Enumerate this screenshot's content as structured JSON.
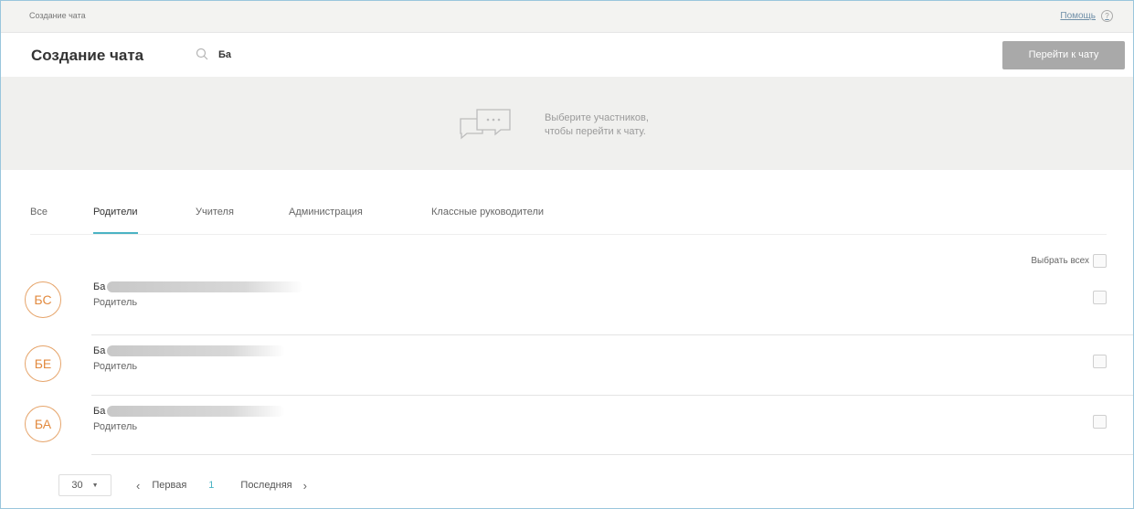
{
  "breadcrumb": "Создание чата",
  "help": {
    "label": "Помощь",
    "icon": "question-icon"
  },
  "header": {
    "title": "Создание чата",
    "search_icon": "search-icon",
    "search_value": "Ба",
    "go_button": "Перейти к чату"
  },
  "banner": {
    "icon": "chat-bubbles-icon",
    "line1": "Выберите участников,",
    "line2": "чтобы перейти к чату."
  },
  "tabs": [
    {
      "label": "Все",
      "active": false
    },
    {
      "label": "Родители",
      "active": true
    },
    {
      "label": "Учителя",
      "active": false
    },
    {
      "label": "Администрация",
      "active": false
    },
    {
      "label": "Классные руководители",
      "active": false
    }
  ],
  "select_all": "Выбрать всех",
  "users": [
    {
      "initials": "БС",
      "name": "Ба",
      "role": "Родитель",
      "checked": false
    },
    {
      "initials": "БЕ",
      "name": "Ба",
      "role": "Родитель",
      "checked": false
    },
    {
      "initials": "БА",
      "name": "Ба",
      "role": "Родитель",
      "checked": false
    }
  ],
  "pagination": {
    "page_size": "30",
    "prev_icon": "chevron-left-icon",
    "first": "Первая",
    "current": "1",
    "last": "Последняя",
    "next_icon": "chevron-right-icon"
  },
  "colors": {
    "accent": "#4bb3c4",
    "avatar": "#e28a3f",
    "button_disabled": "#a9a9a9",
    "banner_bg": "#f0f0ee"
  }
}
